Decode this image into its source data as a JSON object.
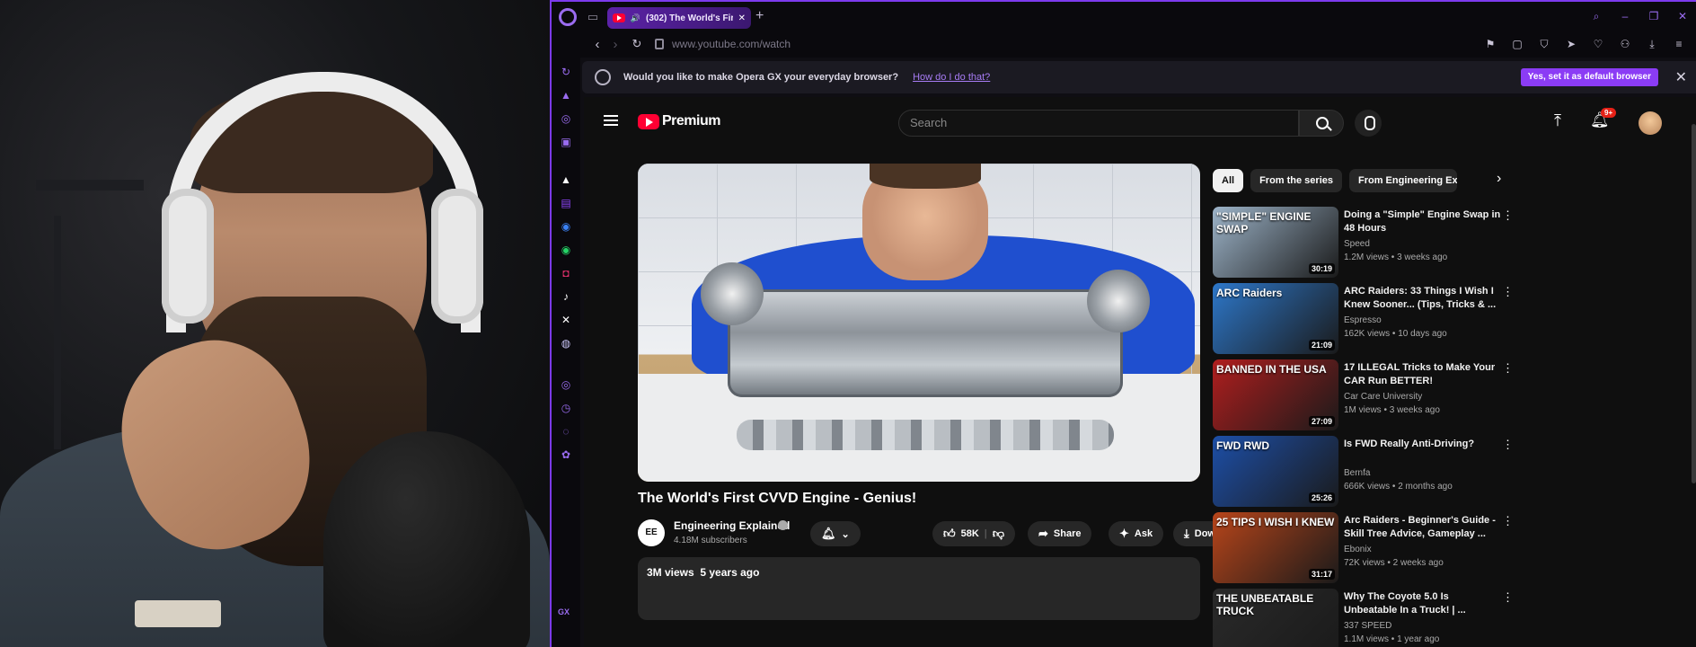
{
  "browser": {
    "tab_title": "(302) The World's Fir",
    "url": "www.youtube.com/watch",
    "infobar": {
      "message": "Would you like to make Opera GX your everyday browser?",
      "link": "How do I do that?",
      "button": "Yes, set it as default browser",
      "close": "✕"
    },
    "sidebar_label": "GX",
    "accent": "#7c3aed"
  },
  "youtube": {
    "logo": "Premium",
    "search_placeholder": "Search",
    "notification_count": "9+",
    "video": {
      "title": "The World's First CVVD Engine - Genius!",
      "channel": "Engineering Explained",
      "channel_avatar_text": "EE",
      "subscribers": "4.18M subscribers",
      "likes": "58K",
      "share": "Share",
      "ask": "Ask",
      "download": "Download",
      "views": "3M views",
      "age": "5 years ago"
    },
    "chips": [
      "All",
      "From the series",
      "From Engineering Explai"
    ],
    "recommendations": [
      {
        "title": "Doing a \"Simple\" Engine Swap in 48 Hours",
        "channel": "Speed",
        "verified": true,
        "views": "1.2M views",
        "age": "3 weeks ago",
        "duration": "30:19",
        "thumb_text": "\"SIMPLE\" ENGINE SWAP",
        "thumb_color": "#9db4c9"
      },
      {
        "title": "ARC Raiders: 33 Things I Wish I Knew Sooner... (Tips, Tricks & ...",
        "channel": "Espresso",
        "verified": true,
        "views": "162K views",
        "age": "10 days ago",
        "duration": "21:09",
        "thumb_text": "ARC Raiders",
        "thumb_color": "#2d77c9"
      },
      {
        "title": "17 ILLEGAL Tricks to Make Your CAR Run BETTER!",
        "channel": "Car Care University",
        "verified": false,
        "views": "1M views",
        "age": "3 weeks ago",
        "duration": "27:09",
        "thumb_text": "BANNED IN THE USA",
        "thumb_color": "#b01e1e"
      },
      {
        "title": "Is FWD Really Anti-Driving?",
        "channel": "Bernfa",
        "verified": false,
        "views": "666K views",
        "age": "2 months ago",
        "duration": "25:26",
        "thumb_text": "FWD  RWD",
        "thumb_color": "#1d4fa8"
      },
      {
        "title": "Arc Raiders - Beginner's Guide - Skill Tree Advice, Gameplay ...",
        "channel": "Ebonix",
        "verified": false,
        "views": "72K views",
        "age": "2 weeks ago",
        "duration": "31:17",
        "thumb_text": "25 TIPS I WISH I KNEW",
        "thumb_color": "#b8451a"
      },
      {
        "title": "Why The Coyote 5.0 Is Unbeatable In a Truck! | ...",
        "channel": "337 SPEED",
        "verified": false,
        "views": "1.1M views",
        "age": "1 year ago",
        "duration": "",
        "thumb_text": "THE UNBEATABLE TRUCK",
        "thumb_color": "#2a2a2a"
      }
    ]
  }
}
